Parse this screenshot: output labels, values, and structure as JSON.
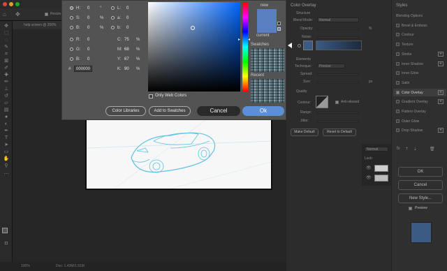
{
  "app": {
    "tab_title": "help screen @ 200%",
    "options_label": "Resize",
    "status": {
      "zoom": "100%",
      "doc": "Doc: 1.43M/1.91M"
    }
  },
  "picker": {
    "fields_left": [
      {
        "label": "H:",
        "value": "0",
        "unit": "°",
        "selected": true
      },
      {
        "label": "S:",
        "value": "0",
        "unit": "%",
        "selected": false
      },
      {
        "label": "B:",
        "value": "0",
        "unit": "%",
        "selected": false
      },
      {
        "label": "R:",
        "value": "0",
        "unit": "",
        "selected": false
      },
      {
        "label": "G:",
        "value": "0",
        "unit": "",
        "selected": false
      },
      {
        "label": "B:",
        "value": "0",
        "unit": "",
        "selected": false
      }
    ],
    "fields_lab": [
      {
        "label": "L:",
        "value": "0"
      },
      {
        "label": "a:",
        "value": "0"
      },
      {
        "label": "b:",
        "value": "0"
      }
    ],
    "fields_cmyk": [
      {
        "label": "C:",
        "value": "75",
        "unit": "%"
      },
      {
        "label": "M:",
        "value": "68",
        "unit": "%"
      },
      {
        "label": "Y:",
        "value": "67",
        "unit": "%"
      },
      {
        "label": "K:",
        "value": "90",
        "unit": "%"
      }
    ],
    "hex_label": "#",
    "hex": "000000",
    "new_label": "new",
    "current_label": "current",
    "swatches_label": "Swatches",
    "recent_label": "Recent",
    "only_web_colors": "Only Web Colors",
    "buttons": {
      "libraries": "Color Libraries",
      "add": "Add to Swatches",
      "cancel": "Cancel",
      "ok": "Ok"
    },
    "colors": {
      "new": "#5a7fc0",
      "ok": "#5b8fd6"
    }
  },
  "layer_style": {
    "title": "Color Overlay",
    "structure": "Structure",
    "blend_mode_label": "Blend Mode:",
    "blend_mode": "Normal",
    "opacity_label": "Opacity:",
    "opacity_unit": "%",
    "noise_label": "Noise:",
    "elements": "Elements",
    "technique_label": "Technique:",
    "technique": "Precise",
    "spread_label": "Spread:",
    "size_label": "Size:",
    "size_unit": "px",
    "quality": "Quality",
    "contour_label": "Contour:",
    "anti_aliased": "Anti-aliased",
    "range_label": "Range:",
    "jitter_label": "Jitter:",
    "make_default": "Make Default",
    "reset_default": "Reset to Default",
    "styles_header": "Styles",
    "styles": [
      {
        "label": "Blending Options",
        "checkbox": false,
        "checked": false,
        "plus": false,
        "active": false
      },
      {
        "label": "Bevel & Emboss",
        "checkbox": true,
        "checked": false,
        "plus": false,
        "active": false
      },
      {
        "label": "Contour",
        "checkbox": true,
        "checked": false,
        "plus": false,
        "active": false
      },
      {
        "label": "Texture",
        "checkbox": true,
        "checked": false,
        "plus": false,
        "active": false
      },
      {
        "label": "Stroke",
        "checkbox": true,
        "checked": false,
        "plus": true,
        "active": false
      },
      {
        "label": "Inner Shadow",
        "checkbox": true,
        "checked": false,
        "plus": true,
        "active": false
      },
      {
        "label": "Inner Glow",
        "checkbox": true,
        "checked": false,
        "plus": false,
        "active": false
      },
      {
        "label": "Satin",
        "checkbox": true,
        "checked": false,
        "plus": false,
        "active": false
      },
      {
        "label": "Color Overlay",
        "checkbox": true,
        "checked": true,
        "plus": true,
        "active": true
      },
      {
        "label": "Gradient Overlay",
        "checkbox": true,
        "checked": false,
        "plus": true,
        "active": false
      },
      {
        "label": "Pattern Overlay",
        "checkbox": true,
        "checked": false,
        "plus": false,
        "active": false
      },
      {
        "label": "Outer Glow",
        "checkbox": true,
        "checked": false,
        "plus": false,
        "active": false
      },
      {
        "label": "Drop Shadow",
        "checkbox": true,
        "checked": false,
        "plus": true,
        "active": false
      }
    ],
    "buttons": {
      "ok": "OK",
      "cancel": "Cancel",
      "new_style": "New Style...",
      "preview": "Preview"
    },
    "layers_blend": "Normal",
    "lock_label": "Lock:",
    "preview_color": "#3b5a84"
  }
}
